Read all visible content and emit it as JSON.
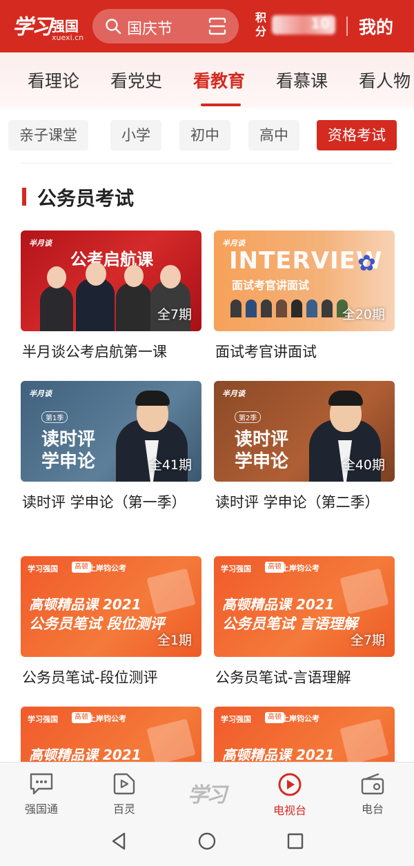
{
  "header": {
    "logo_script": "学习",
    "logo_name": "强国",
    "logo_domain": "xuexi.cn",
    "search_placeholder": "国庆节",
    "points_label": "积分",
    "points_value": "10",
    "mine": "我的"
  },
  "tabs": [
    "看理论",
    "看党史",
    "看教育",
    "看慕课",
    "看人物"
  ],
  "active_tab": "看教育",
  "subtabs": [
    "亲子课堂",
    "小学",
    "初中",
    "高中",
    "资格考试"
  ],
  "active_subtab": "资格考试",
  "section_title": "公务员考试",
  "cards": [
    {
      "title": "半月谈公考启航第一课",
      "episodes": "全7期",
      "thumb_text": "公考启航课",
      "brand": "半月谈"
    },
    {
      "title": "面试考官讲面试",
      "episodes": "全20期",
      "thumb_text": "INTERVIEW",
      "thumb_sub": "面试考官讲面试",
      "brand": "半月谈"
    },
    {
      "title": "读时评 学申论（第一季）",
      "episodes": "全41期",
      "thumb_line1": "读时评",
      "thumb_line2": "学申论",
      "season": "第1季",
      "brand": "半月谈"
    },
    {
      "title": "读时评 学申论（第二季）",
      "episodes": "全40期",
      "thumb_line1": "读时评",
      "thumb_line2": "学申论",
      "season": "第2季",
      "brand": "半月谈"
    },
    {
      "title": "公务员笔试-段位测评",
      "episodes": "全1期",
      "thumb_line1": "高顿精品课 2021",
      "thumb_line2": "公务员笔试 段位测评",
      "top": "学习强国",
      "badge": "高顿",
      "sub": "上岸钧公考"
    },
    {
      "title": "公务员笔试-言语理解",
      "episodes": "全7期",
      "thumb_line1": "高顿精品课 2021",
      "thumb_line2": "公务员笔试 言语理解",
      "top": "学习强国",
      "badge": "高顿",
      "sub": "上岸钧公考"
    },
    {
      "title": "",
      "episodes": "",
      "thumb_line1": "高顿精品课 2021",
      "top": "学习强国",
      "badge": "高顿",
      "sub": "上岸钧公考"
    },
    {
      "title": "",
      "episodes": "",
      "thumb_line1": "高顿精品课 2021",
      "top": "学习强国",
      "badge": "高顿",
      "sub": "上岸钧公考"
    }
  ],
  "bottom_nav": [
    {
      "label": "强国通",
      "icon": "chat-icon"
    },
    {
      "label": "百灵",
      "icon": "play-tag-icon"
    },
    {
      "label": "学习",
      "icon": "xuexi-logo"
    },
    {
      "label": "电视台",
      "icon": "play-circle-icon"
    },
    {
      "label": "电台",
      "icon": "radio-icon"
    }
  ],
  "active_nav": "电视台",
  "colors": {
    "primary": "#d42a20"
  }
}
